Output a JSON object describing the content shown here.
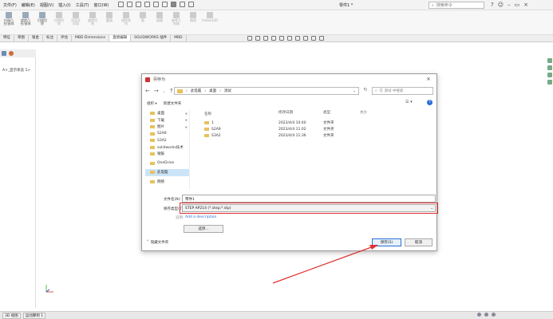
{
  "menu": [
    "文件(F)",
    "编辑(E)",
    "视图(V)",
    "插入(I)",
    "工具(T)",
    "窗口(W)"
  ],
  "doc_title": "零件1 *",
  "search": {
    "placeholder": "搜索命令"
  },
  "ribbon": [
    {
      "label": "拉伸凸台/基体",
      "dim": false
    },
    {
      "label": "旋转凸台/基体",
      "dim": false
    },
    {
      "label": "扫描切除",
      "dim": false
    },
    {
      "label": "拉伸切除",
      "dim": true
    },
    {
      "label": "异型孔向导",
      "dim": true
    },
    {
      "label": "旋转切除",
      "dim": true
    },
    {
      "label": "圆角",
      "dim": true
    },
    {
      "label": "线性阵列",
      "dim": true
    },
    {
      "label": "筋",
      "dim": true
    },
    {
      "label": "拔模",
      "dim": true
    },
    {
      "label": "参考几何体",
      "dim": true
    },
    {
      "label": "曲线",
      "dim": true
    },
    {
      "label": "Instant3D",
      "dim": true
    }
  ],
  "cm_tabs": [
    "特征",
    "草图",
    "钣金",
    "标注",
    "评估",
    "MBD Dimensions",
    "直接编辑",
    "SOLIDWORKS 插件",
    "MBD"
  ],
  "cm_active": 6,
  "tree_text": "A>_显示状态 1>",
  "dialog": {
    "title": "另存为",
    "breadcrumb": [
      "此电脑",
      "桌面",
      "测试"
    ],
    "search_placeholder": "在 测试 中搜索",
    "organize": "组织 ▾",
    "new_folder": "新建文件夹",
    "nav_items": [
      {
        "label": "桌面",
        "pin": "✱",
        "gap": false
      },
      {
        "label": "下载",
        "pin": "✱",
        "gap": false
      },
      {
        "label": "图片",
        "pin": "✱",
        "gap": false
      },
      {
        "label": "S2A9",
        "pin": "",
        "gap": false
      },
      {
        "label": "S3A2",
        "pin": "",
        "gap": false
      },
      {
        "label": "solidworks技术",
        "pin": "",
        "gap": false
      },
      {
        "label": "钢筋",
        "pin": "",
        "gap": false
      },
      {
        "label": "OneDrive",
        "pin": "",
        "gap": true
      },
      {
        "label": "此电脑",
        "pin": "",
        "gap": true
      },
      {
        "label": "网络",
        "pin": "",
        "gap": true
      }
    ],
    "columns": [
      "名称",
      "修改日期",
      "类型",
      "大小"
    ],
    "files": [
      {
        "name": "1",
        "date": "2023/4/4 10:40",
        "type": "文件夹",
        "size": ""
      },
      {
        "name": "S2A9",
        "date": "2023/4/4 11:02",
        "type": "文件夹",
        "size": ""
      },
      {
        "name": "S3A2",
        "date": "2023/4/4 11:36",
        "type": "文件夹",
        "size": ""
      }
    ],
    "filename_label": "文件名(N):",
    "filename_value": "零件1",
    "filetype_label": "保存类型(T):",
    "filetype_value": "STEP AP214 (*.step;*.stp)",
    "desc_label": "说明:",
    "desc_value": "Add a description",
    "options_label": "选项...",
    "hide_label": "隐藏文件夹",
    "save_label": "保存(S)",
    "cancel_label": "取消"
  },
  "status_tabs": [
    "3D 视图",
    "运动算例 1"
  ],
  "colors": {
    "accent": "#2a6fd6",
    "highlight": "#e03030",
    "folder": "#e8c15e"
  }
}
